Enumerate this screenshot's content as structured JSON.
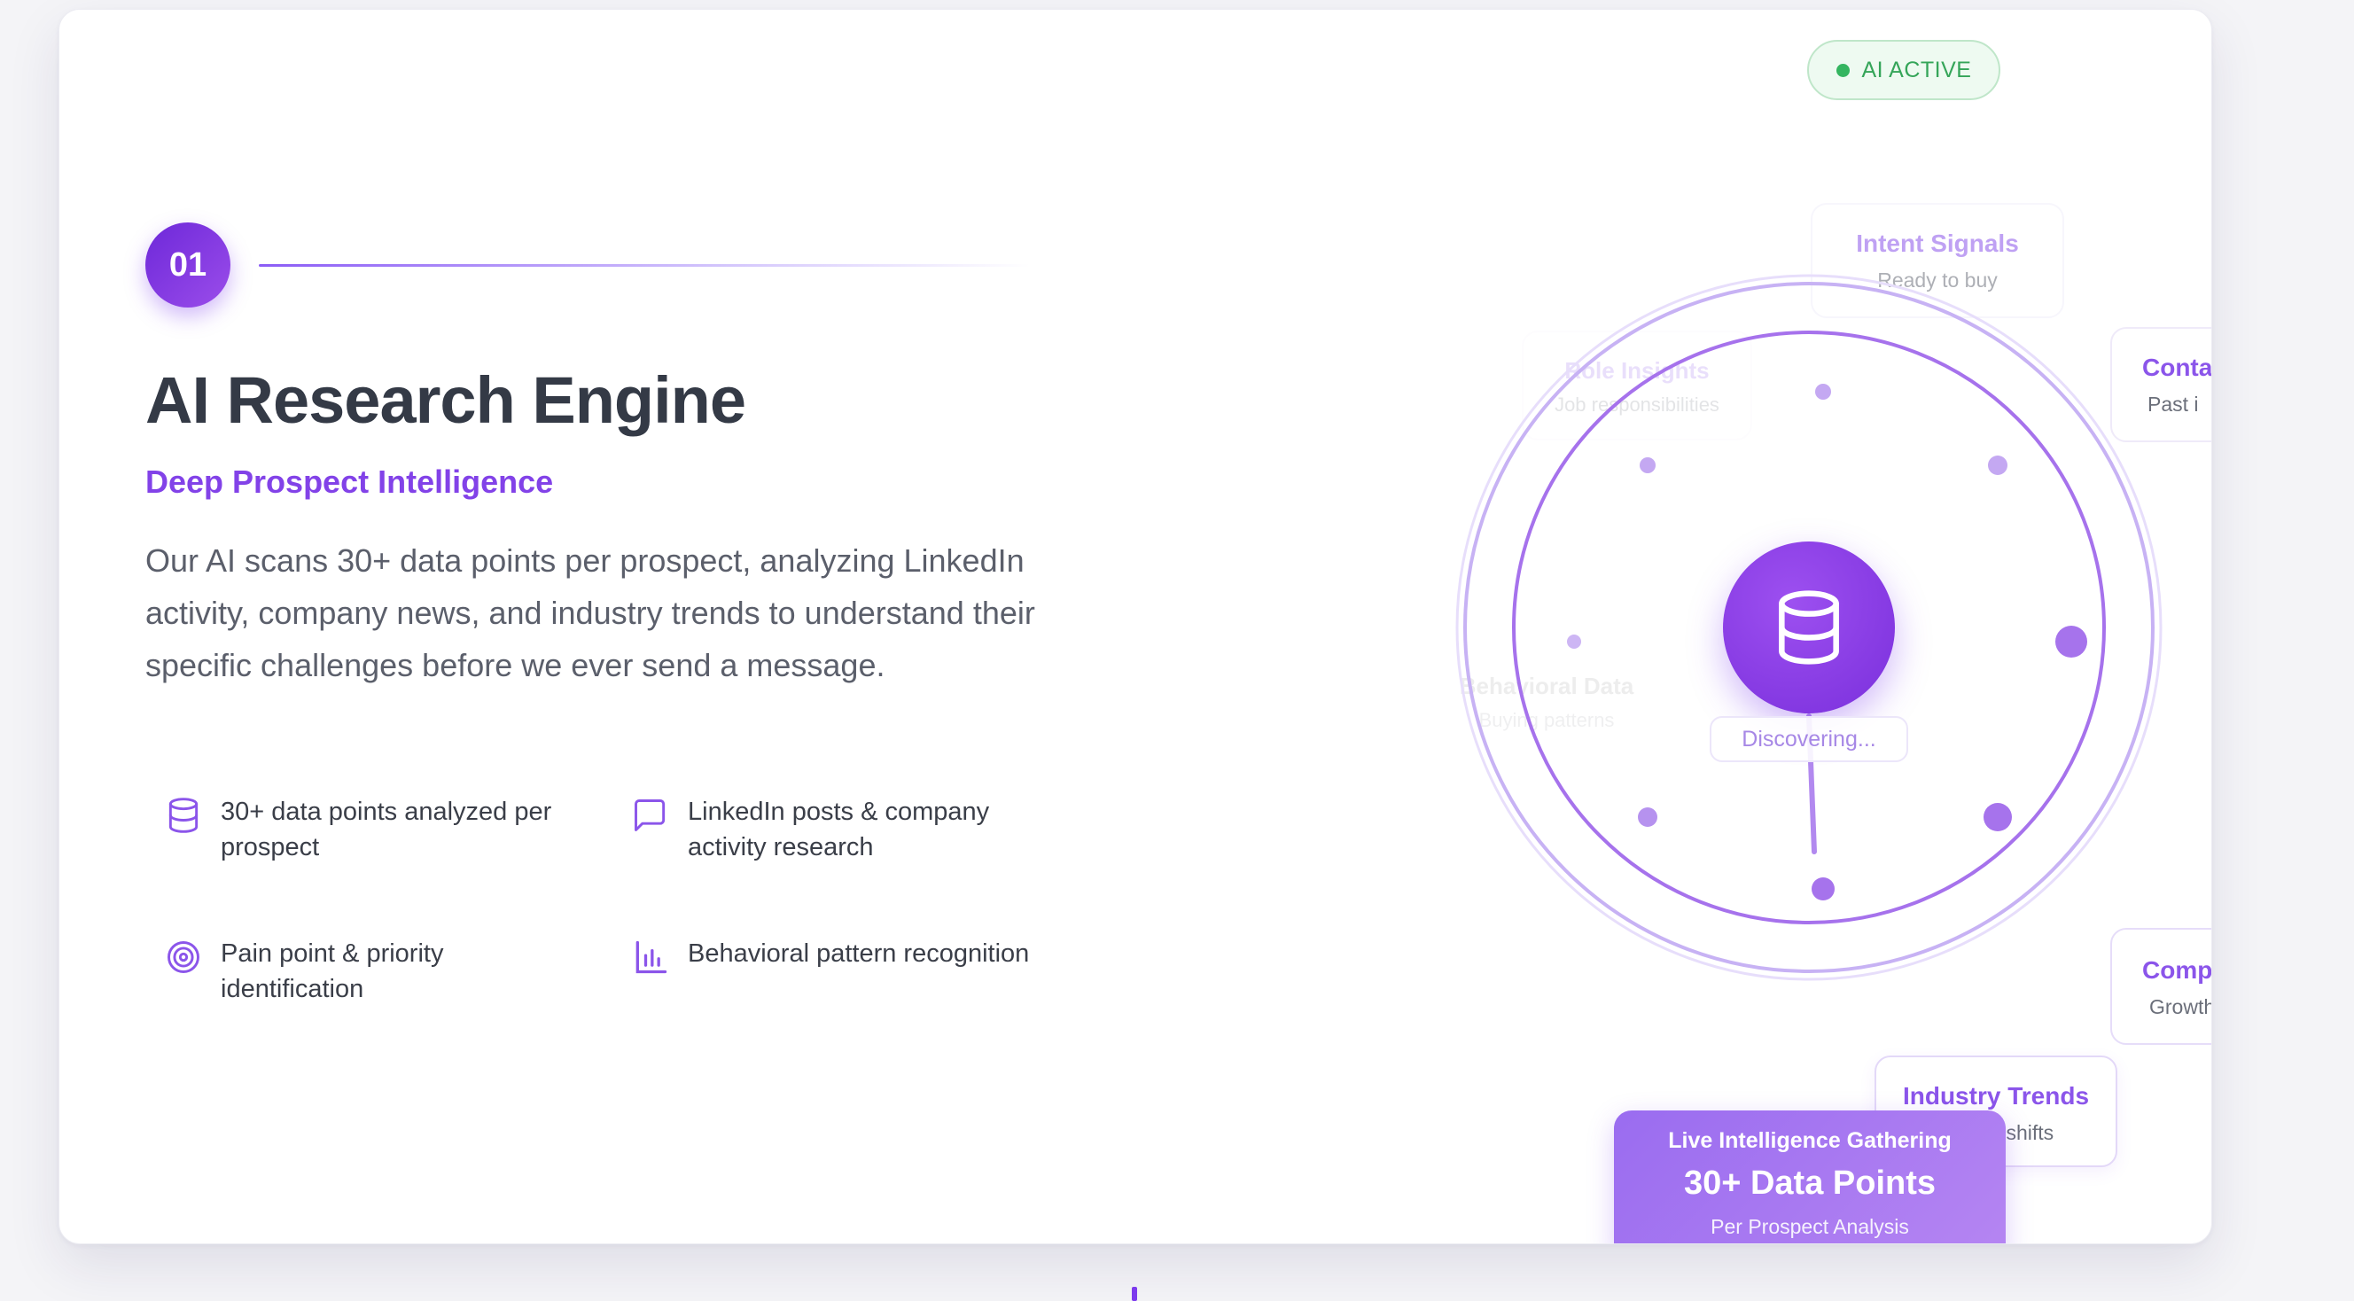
{
  "step": {
    "number": "01"
  },
  "hero": {
    "title": "AI Research Engine",
    "subtitle": "Deep Prospect Intelligence",
    "description": "Our AI scans 30+ data points per prospect, analyzing LinkedIn activity, company news, and industry trends to understand their specific challenges before we ever send a message."
  },
  "features": [
    {
      "icon": "database-icon",
      "text": "30+ data points analyzed per prospect"
    },
    {
      "icon": "message-square-icon",
      "text": "LinkedIn posts & company activity research"
    },
    {
      "icon": "target-icon",
      "text": "Pain point & priority identification"
    },
    {
      "icon": "bar-chart-icon",
      "text": "Behavioral pattern recognition"
    }
  ],
  "status": {
    "label": "AI ACTIVE",
    "color": "#34b560"
  },
  "orbit_cards": {
    "intent": {
      "title": "Intent Signals",
      "sub": "Ready to buy"
    },
    "role": {
      "title": "Role Insights",
      "sub": "Job responsibilities"
    },
    "contact": {
      "title": "Conta",
      "sub": "Past i"
    },
    "behavioral": {
      "title": "Behavioral Data",
      "sub": "Buying patterns"
    },
    "company": {
      "title": "Comp",
      "sub": "Growth"
    },
    "industry": {
      "title": "Industry Trends",
      "sub": "Market shifts"
    }
  },
  "hub": {
    "icon": "database-icon",
    "status": "Discovering..."
  },
  "live": {
    "heading": "Live Intelligence Gathering",
    "value": "30+ Data Points",
    "caption": "Per Prospect Analysis"
  },
  "colors": {
    "accent": "#7c3aed",
    "heading": "#343a46",
    "subtitle": "#8242e8"
  }
}
